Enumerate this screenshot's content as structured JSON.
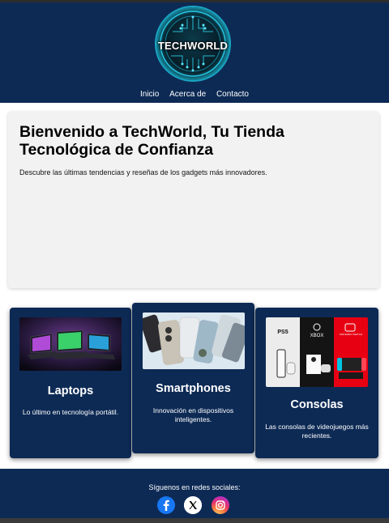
{
  "header": {
    "logo_text": "TECHWORLD",
    "nav": [
      "Inicio",
      "Acerca de",
      "Contacto"
    ]
  },
  "hero": {
    "title": "Bienvenido a TechWorld, Tu Tienda Tecnológica de Confianza",
    "subtitle": "Descubre las últimas tendencias y reseñas de los gadgets más innovadores."
  },
  "cards": [
    {
      "title": "Laptops",
      "text": "Lo último en tecnología portátil."
    },
    {
      "title": "Smartphones",
      "text": "Innovación en dispositivos inteligentes."
    },
    {
      "title": "Consolas",
      "text": "Las consolas de videojuegos más recientes.",
      "image_labels": [
        "PS5",
        "XBOX",
        "NINTENDO SWITCH"
      ]
    }
  ],
  "footer": {
    "follow_text": "Síguenos en redes sociales:",
    "social_icons": [
      "facebook-icon",
      "x-icon",
      "instagram-icon"
    ]
  },
  "colors": {
    "navy": "#0d2a55",
    "hero_bg": "#f2f2f2",
    "facebook": "#1877f2"
  }
}
